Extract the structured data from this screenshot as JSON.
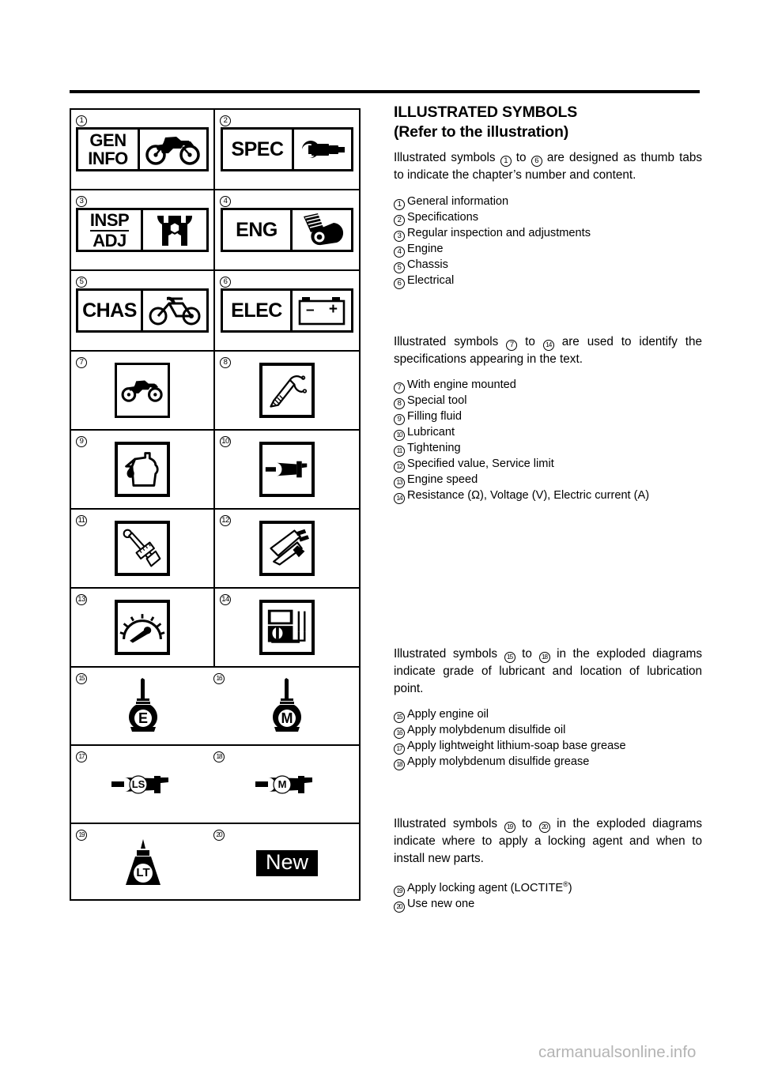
{
  "document": {
    "title": "ILLUSTRATED SYMBOLS",
    "subtitle": "(Refer to the illustration)",
    "watermark": "carmanualsonline.info"
  },
  "sections": [
    {
      "id": "chapter-tabs",
      "paragraph": "Illustrated symbols ① to ⑥ are designed as thumb tabs to indicate the chapter’s number and content.",
      "paragraph_parts": {
        "lead": "Illustrated symbols",
        "from": "1",
        "middle": "to",
        "to": "6",
        "tail": "are designed as thumb tabs to indicate the chapter’s number and content."
      },
      "items": [
        {
          "num": "1",
          "label": "General information"
        },
        {
          "num": "2",
          "label": "Specifications"
        },
        {
          "num": "3",
          "label": "Regular inspection and adjustments"
        },
        {
          "num": "4",
          "label": "Engine"
        },
        {
          "num": "5",
          "label": "Chassis"
        },
        {
          "num": "6",
          "label": "Electrical"
        }
      ]
    },
    {
      "id": "specification-symbols",
      "paragraph_parts": {
        "lead": "Illustrated symbols",
        "from": "7",
        "middle": "to",
        "to": "14",
        "tail": "are used to identify the specifications appearing in the text."
      },
      "items": [
        {
          "num": "7",
          "label": "With engine mounted"
        },
        {
          "num": "8",
          "label": "Special tool"
        },
        {
          "num": "9",
          "label": "Filling fluid"
        },
        {
          "num": "10",
          "label": "Lubricant"
        },
        {
          "num": "11",
          "label": "Tightening"
        },
        {
          "num": "12",
          "label": "Specified value, Service limit"
        },
        {
          "num": "13",
          "label": "Engine speed"
        },
        {
          "num": "14",
          "label": "Resistance (Ω), Voltage (V), Electric current (A)"
        }
      ]
    },
    {
      "id": "lubricant-symbols",
      "paragraph_parts": {
        "lead": "Illustrated symbols",
        "from": "15",
        "middle": "to",
        "to": "18",
        "tail": "in the exploded diagrams indicate grade of lubricant and location of lubrication point."
      },
      "items": [
        {
          "num": "15",
          "label": "Apply engine oil"
        },
        {
          "num": "16",
          "label": "Apply molybdenum disulfide oil"
        },
        {
          "num": "17",
          "label": "Apply lightweight lithium-soap base grease"
        },
        {
          "num": "18",
          "label": "Apply molybdenum disulfide grease"
        }
      ]
    },
    {
      "id": "locking-symbols",
      "paragraph_parts": {
        "lead": "Illustrated symbols",
        "from": "19",
        "middle": "to",
        "to": "20",
        "tail": "in the exploded diagrams indicate where to apply a locking agent and when to install new parts."
      },
      "items": [
        {
          "num": "19",
          "label": "Apply locking agent (LOCTITE®)",
          "label_base": "Apply locking agent (LOCTITE",
          "label_sup": "®",
          "label_end": ")"
        },
        {
          "num": "20",
          "label": "Use new one"
        }
      ]
    }
  ],
  "illustration_table": {
    "cells": [
      {
        "num": "1",
        "icon": "tab-gen-info-icon",
        "tab_line1": "GEN",
        "tab_line2": "INFO",
        "pictogram": "dirt-bike"
      },
      {
        "num": "2",
        "icon": "tab-spec-icon",
        "tab_line1": "SPEC",
        "pictogram": "micrometer"
      },
      {
        "num": "3",
        "icon": "tab-insp-adj-icon",
        "tab_line1": "INSP",
        "tab_line2": "ADJ",
        "pictogram": "wrench-nut"
      },
      {
        "num": "4",
        "icon": "tab-eng-icon",
        "tab_line1": "ENG",
        "pictogram": "piston"
      },
      {
        "num": "5",
        "icon": "tab-chas-icon",
        "tab_line1": "CHAS",
        "pictogram": "bike-frame"
      },
      {
        "num": "6",
        "icon": "tab-elec-icon",
        "tab_line1": "ELEC",
        "pictogram": "battery",
        "battery_minus": "–",
        "battery_plus": "+"
      },
      {
        "num": "7",
        "icon": "with-engine-mounted-icon",
        "pictogram": "motorcycle-silhouette"
      },
      {
        "num": "8",
        "icon": "special-tool-icon",
        "pictogram": "hook-wrench"
      },
      {
        "num": "9",
        "icon": "filling-fluid-icon",
        "pictogram": "oil-can-drop"
      },
      {
        "num": "10",
        "icon": "lubricant-icon",
        "pictogram": "grease-gun"
      },
      {
        "num": "11",
        "icon": "tightening-icon",
        "pictogram": "torque-wrench"
      },
      {
        "num": "12",
        "icon": "specified-value-icon",
        "pictogram": "vernier-caliper"
      },
      {
        "num": "13",
        "icon": "engine-speed-icon",
        "pictogram": "tachometer"
      },
      {
        "num": "14",
        "icon": "electrical-measure-icon",
        "pictogram": "multimeter"
      },
      {
        "num": "15",
        "icon": "apply-engine-oil-icon",
        "pictogram": "oiler-bottle",
        "mark": "E"
      },
      {
        "num": "16",
        "icon": "apply-moly-oil-icon",
        "pictogram": "oiler-bottle",
        "mark": "M"
      },
      {
        "num": "17",
        "icon": "apply-lithium-grease-icon",
        "pictogram": "grease-gun-marked",
        "mark": "LS"
      },
      {
        "num": "18",
        "icon": "apply-moly-grease-icon",
        "pictogram": "grease-gun-marked",
        "mark": "M"
      },
      {
        "num": "19",
        "icon": "apply-locking-agent-icon",
        "pictogram": "locking-agent-bottle",
        "mark": "LT"
      },
      {
        "num": "20",
        "icon": "use-new-one-icon",
        "pictogram": "new-badge",
        "mark": "New"
      }
    ]
  }
}
